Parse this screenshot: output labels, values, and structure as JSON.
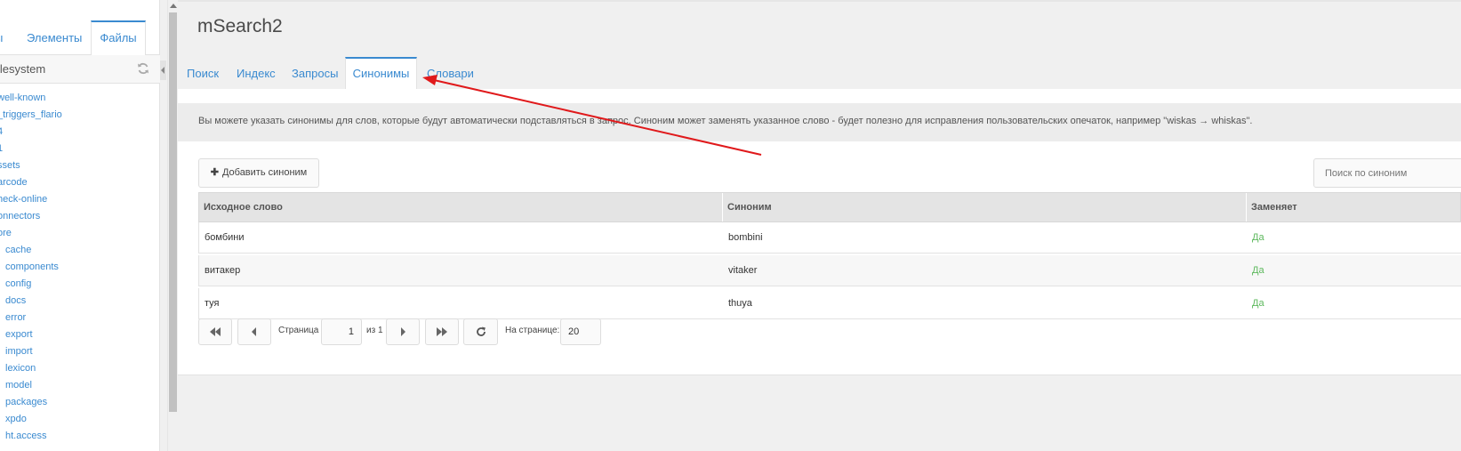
{
  "left_panel": {
    "tabs": [
      "ы",
      "Элементы",
      "Файлы"
    ],
    "header_title": "ilesystem",
    "refresh_icon": "refresh-icon",
    "tree": [
      "well-known",
      "_triggers_flario",
      "4",
      "1",
      "ssets",
      "arcode",
      "heck-online",
      "onnectors",
      "ore",
      "cache",
      "components",
      "config",
      "docs",
      "error",
      "export",
      "import",
      "lexicon",
      "model",
      "packages",
      "xpdo",
      "ht.access"
    ]
  },
  "main": {
    "title": "mSearch2",
    "tabs": [
      "Поиск",
      "Индекс",
      "Запросы",
      "Синонимы",
      "Словари"
    ],
    "active_tab": "Синонимы",
    "description": "Вы можете указать синонимы для слов, которые будут автоматически подставляться в запрос. Синоним может заменять указанное слово - будет полезно для исправления пользовательских опечаток, например \"wiskas → whiskas\".",
    "add_button": "Добавить синоним",
    "search_placeholder": "Поиск по синоним",
    "grid": {
      "columns": [
        "Исходное слово",
        "Синоним",
        "Заменяет"
      ],
      "rows": [
        [
          "бомбини",
          "bombini",
          "Да"
        ],
        [
          "витакер",
          "vitaker",
          "Да"
        ],
        [
          "туя",
          "thuya",
          "Да"
        ]
      ]
    },
    "pager": {
      "page_label": "Страница",
      "page_value": "1",
      "of_label": "из 1",
      "per_page_label": "На странице:",
      "per_page_value": "20"
    }
  },
  "colors": {
    "accent": "#3a8ad0",
    "yes_green": "#5cb85c",
    "annotation_arrow": "#e0191b"
  }
}
